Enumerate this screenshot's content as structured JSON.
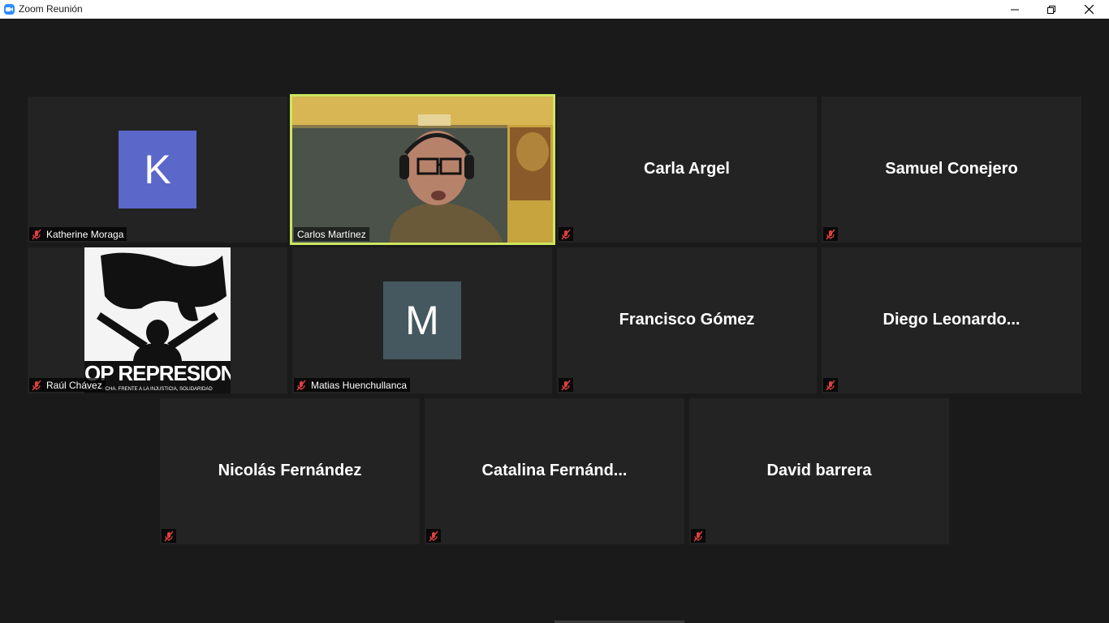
{
  "window": {
    "title": "Zoom Reunión"
  },
  "colors": {
    "active_speaker_border": "#cde660",
    "muted_icon": "#e04040",
    "avatar_k": "#5b67c9",
    "avatar_m": "#45585f"
  },
  "participants": {
    "katherine": {
      "name": "Katherine Moraga",
      "avatar_letter": "K"
    },
    "carlos": {
      "name": "Carlos Martínez"
    },
    "carla": {
      "name": "Carla Argel"
    },
    "samuel": {
      "name": "Samuel Conejero"
    },
    "raul": {
      "name": "Raúl Chávez",
      "banner": "OP REPRESION",
      "banner_sub": "SION, LUCHA. FRENTE A LA INJUSTICIA, SOLIDARIDAD"
    },
    "matias": {
      "name": "Matias Huenchullanca",
      "avatar_letter": "M"
    },
    "francisco": {
      "name": "Francisco Gómez"
    },
    "diego": {
      "name": "Diego  Leonardo..."
    },
    "nicolas": {
      "name": "Nicolás Fernández"
    },
    "catalina": {
      "name": "Catalina  Fernánd..."
    },
    "david": {
      "name": "David barrera"
    }
  }
}
